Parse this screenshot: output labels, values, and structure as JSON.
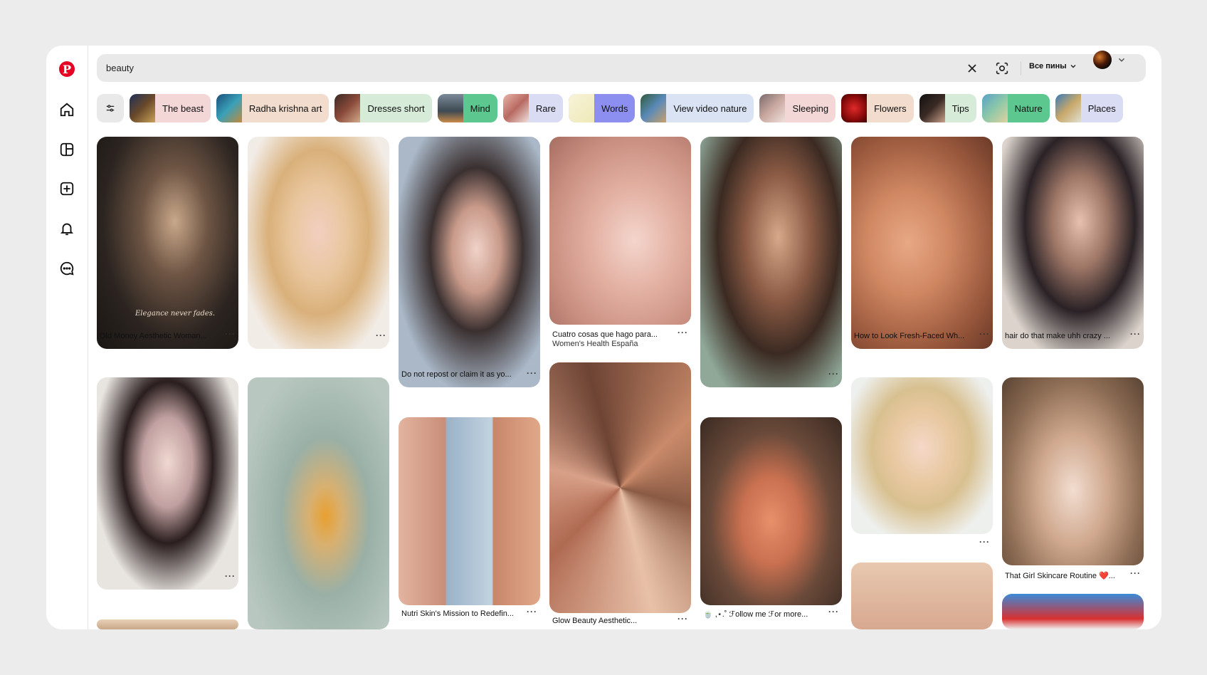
{
  "search": {
    "query": "beauty"
  },
  "header": {
    "all_pins_label": "Все пины"
  },
  "chips": [
    {
      "label": "The beast",
      "bg": "#f3d6d6",
      "thumb": "linear-gradient(135deg,#1d2f5a,#6a4a2a 50%,#c9a25a)"
    },
    {
      "label": "Radha krishna art",
      "bg": "#f1dccd",
      "thumb": "linear-gradient(135deg,#1b4f7a,#3aa0b8 50%,#c28a3a)"
    },
    {
      "label": "Dresses short",
      "bg": "#d6ecd9",
      "thumb": "linear-gradient(135deg,#3a2a24,#8a4a3a 50%,#d2a98a)"
    },
    {
      "label": "Mind",
      "bg": "#5cc78e",
      "thumb": "linear-gradient(180deg,#7c8a9a,#3d4a52 60%,#c98a4a)"
    },
    {
      "label": "Rare",
      "bg": "#d9dcf3",
      "thumb": "linear-gradient(135deg,#e8b4a8,#b86a62 50%,#efe0dc)"
    },
    {
      "label": "Words",
      "bg": "#8c8ff0",
      "thumb": "linear-gradient(135deg,#f7f3d8,#efe9b8)"
    },
    {
      "label": "View video nature",
      "bg": "#d9e3f3",
      "thumb": "linear-gradient(135deg,#2f5a3a,#5a8ab8 50%,#c9a06a)"
    },
    {
      "label": "Sleeping",
      "bg": "#f3d6d6",
      "thumb": "linear-gradient(135deg,#7a6a6a,#c9a8a0 50%,#efe0dc)"
    },
    {
      "label": "Flowers",
      "bg": "#f1dccd",
      "thumb": "radial-gradient(circle at 50% 50%,#e02a2a,#8a0a0a 60%,#3a0404)"
    },
    {
      "label": "Tips",
      "bg": "#d6ecd9",
      "thumb": "linear-gradient(135deg,#111,#3a2a24 50%,#c9a08a)"
    },
    {
      "label": "Nature",
      "bg": "#5cc78e",
      "thumb": "linear-gradient(135deg,#5aa0c8,#8cc8a8 50%,#e0d0a0)"
    },
    {
      "label": "Places",
      "bg": "#d9dcf3",
      "thumb": "linear-gradient(135deg,#3a7ab8,#c8a86a 50%,#e0e0d0)"
    }
  ],
  "pins": [
    {
      "title": "Old Money Aesthetic Woman...",
      "overlay": "Elegance never fades.",
      "img": "radial-gradient(ellipse at 55% 40%,#c9a88a 0%,#6e5544 30%,#2b2420 65%,#1a1613 100%)"
    },
    {
      "title": "",
      "img": "radial-gradient(ellipse at 50% 45%,#f1cfc0 0%,#e9c69e 28%,#d9b07a 50%,#f2ece6 80%)"
    },
    {
      "title": "Do not repost or claim it as yo...",
      "img": "radial-gradient(ellipse at 55% 45%,#f0d2c8 0%,#c89a8a 22%,#3a3030 42%,#aab8c8 75%)"
    },
    {
      "title": "Cuatro cosas que hago para...",
      "sub": "Women's Health España",
      "img": "radial-gradient(ellipse at 60% 55%,#f4d5cc 0%,#e3b1a3 35%,#c98f80 70%,#a66d62 100%)"
    },
    {
      "title": "",
      "img": "radial-gradient(ellipse at 55% 40%,#d8a88a 0%,#8a5a44 30%,#3b2a22 55%,#8fa898 85%)"
    },
    {
      "title": "How to Look Fresh-Faced Wh...",
      "img": "radial-gradient(ellipse at 40% 50%,#e8a884 0%,#cf8762 35%,#9c5a3e 70%,#6b3a28 100%)"
    },
    {
      "title": "hair do that make uhh crazy ...",
      "img": "radial-gradient(ellipse at 55% 40%,#e8c0b0 0%,#a07868 25%,#2a2226 50%,#dcd4cc 80%)"
    },
    {
      "title": "",
      "img": "radial-gradient(ellipse at 50% 40%,#f0d8d0 0%,#c0a0a0 25%,#2a1e1e 45%,#e8e4e0 75%)"
    },
    {
      "title": "",
      "img": "radial-gradient(ellipse at 55% 55%,#e8a030 0%,#d8b070 15%,#9ab0a6 40%,#b8c8c0 80%)"
    },
    {
      "title": "Nutri Skin's Mission to Redefin...",
      "img": "linear-gradient(90deg,#e2b4a0 0%,#c98e78 33%,#9ab2c8 34%,#c2d2e0 66%,#c8866a 67%,#e0a888 100%)"
    },
    {
      "title": "Glow Beauty Aesthetic...",
      "img": "conic-gradient(from 45deg,#c98a6a,#8a5a44,#e8c0a8,#b06a52,#d8a088,#6e4434,#c98a6a)"
    },
    {
      "title": "🍵 ,⋆.˚ ℱollow me ℱor more...",
      "img": "radial-gradient(ellipse at 50% 55%,#e8906a 0%,#c87050 30%,#6a4a3a 60%,#3a2a22 100%)"
    },
    {
      "title": "",
      "img": "radial-gradient(ellipse at 50% 45%,#f4d8c8 0%,#e8c8a0 30%,#d8c090 50%,#eef0ee 80%)"
    },
    {
      "title": "That Girl Skincare Routine ❤️...",
      "img": "radial-gradient(ellipse at 50% 60%,#f2ddd0 0%,#cfa88e 35%,#8a6a52 70%,#5a4434 100%)"
    },
    {
      "title": "",
      "img": "linear-gradient(180deg,#e8c8b0,#d8a890)"
    },
    {
      "title": "",
      "img": "linear-gradient(180deg,#3a8ad8,#d83030 70%,#f0f0f0)"
    },
    {
      "title": "",
      "img": "linear-gradient(180deg,#e8d0b8,#c8a888)"
    }
  ]
}
